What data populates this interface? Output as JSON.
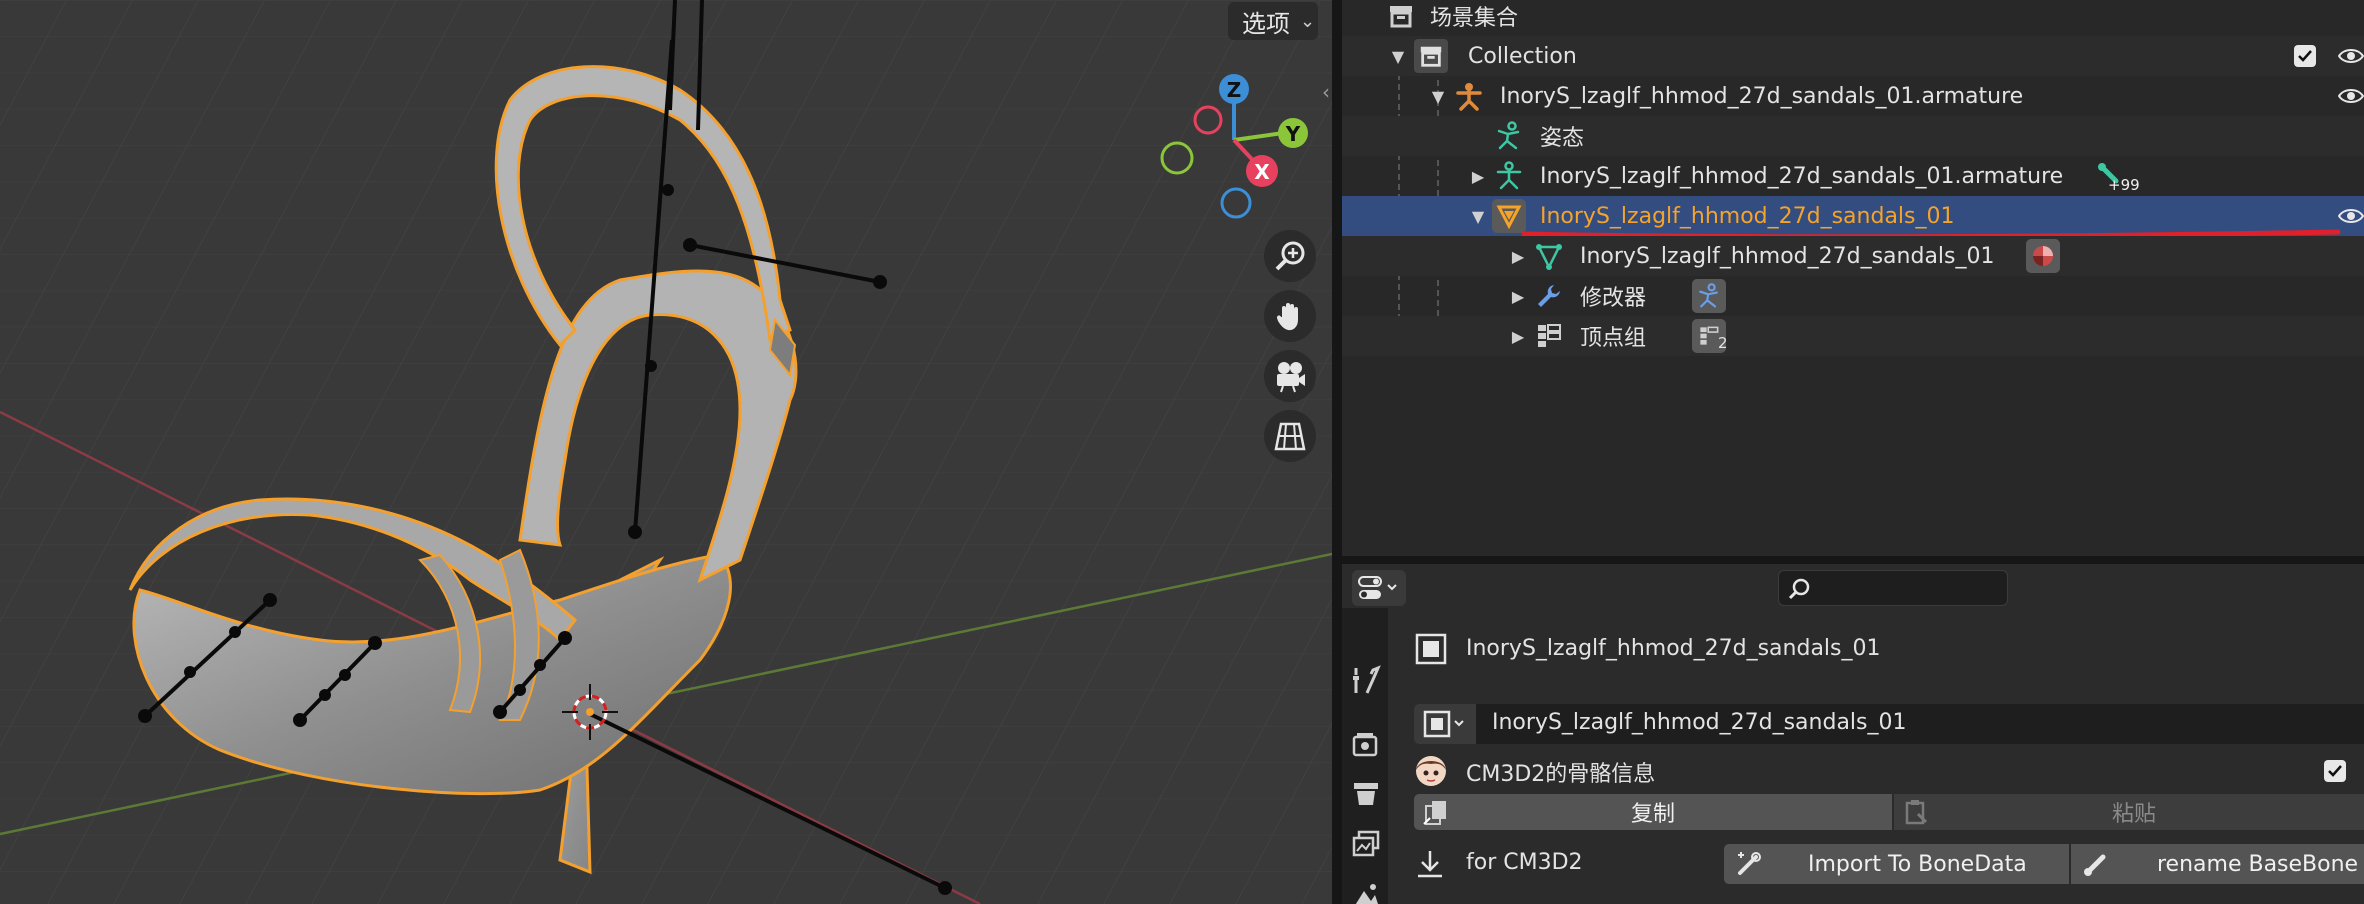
{
  "viewport": {
    "options_label": "选项",
    "gizmo": {
      "z": "Z",
      "y": "Y",
      "x": "X"
    },
    "nav_icons": [
      "zoom-in-icon",
      "hand-pan-icon",
      "camera-icon",
      "grid-perspective-icon"
    ],
    "colors": {
      "background": "#393939",
      "selection_outline": "#f4a02e",
      "x_axis": "#e8415f",
      "y_axis": "#8ac53a",
      "z_axis": "#3c8ed6"
    }
  },
  "outliner": {
    "rows": [
      {
        "label": "场景集合",
        "icon": "scene-collection-icon"
      },
      {
        "label": "Collection",
        "icon": "collection-icon"
      },
      {
        "label": "InoryS_lzaglf_hhmod_27d_sandals_01.armature",
        "icon": "armature-object-icon"
      },
      {
        "label": "姿态",
        "icon": "pose-icon"
      },
      {
        "label": "InoryS_lzaglf_hhmod_27d_sandals_01.armature",
        "icon": "armature-data-icon",
        "badge": "+99"
      },
      {
        "label": "InoryS_lzaglf_hhmod_27d_sandals_01",
        "icon": "mesh-object-icon",
        "selected": true
      },
      {
        "label": "InoryS_lzaglf_hhmod_27d_sandals_01",
        "icon": "mesh-data-icon"
      },
      {
        "label": "修改器",
        "icon": "wrench-icon"
      },
      {
        "label": "顶点组",
        "icon": "vertex-groups-icon",
        "badge": "2"
      }
    ],
    "colors": {
      "selected_row": "#334d80",
      "selected_text": "#f6a32a",
      "annotation_underline": "#e0202a"
    }
  },
  "properties": {
    "object_name": "InoryS_lzaglf_hhmod_27d_sandals_01",
    "data_name": "InoryS_lzaglf_hhmod_27d_sandals_01",
    "panel_title": "CM3D2的骨骼信息",
    "copy_label": "复制",
    "paste_label": "粘贴",
    "for_label": "for CM3D2",
    "import_label": "Import To BoneData",
    "rename_label": "rename BaseBone"
  }
}
